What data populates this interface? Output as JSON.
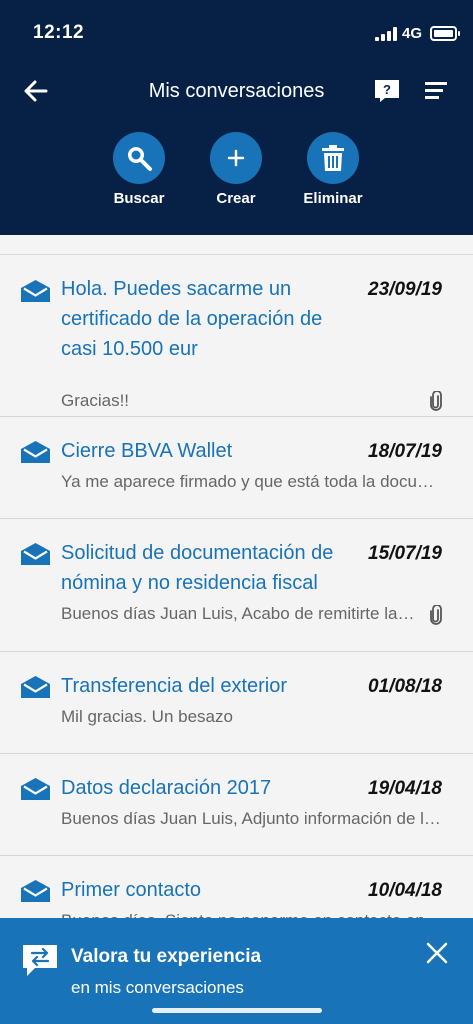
{
  "status_bar": {
    "time": "12:12",
    "network": "4G"
  },
  "header": {
    "title": "Mis conversaciones",
    "actions": [
      {
        "label": "Buscar",
        "icon": "search-icon"
      },
      {
        "label": "Crear",
        "icon": "plus-icon"
      },
      {
        "label": "Eliminar",
        "icon": "trash-icon"
      }
    ]
  },
  "conversations": [
    {
      "subject": "Hola. Puedes sacarme un certificado de la operación de casi 10.500 eur",
      "date": "23/09/19",
      "preview": "Gracias!!",
      "has_attachment": true
    },
    {
      "subject": "Cierre BBVA Wallet",
      "date": "18/07/19",
      "preview": "Ya me aparece firmado y que está toda la documentación",
      "has_attachment": false
    },
    {
      "subject": "Solicitud de documentación de nómina y no residencia fiscal",
      "date": "15/07/19",
      "preview": "Buenos días Juan Luis,  Acabo de remitirte la documentación",
      "has_attachment": true
    },
    {
      "subject": "Transferencia del exterior",
      "date": "01/08/18",
      "preview": "Mil gracias. Un besazo",
      "has_attachment": false
    },
    {
      "subject": "Datos declaración 2017",
      "date": "19/04/18",
      "preview": "Buenos días Juan Luis,  Adjunto información de la declaración",
      "has_attachment": false
    },
    {
      "subject": "Primer contacto",
      "date": "10/04/18",
      "preview": "Buenos días. Siento no ponerme en contacto antes",
      "has_attachment": false
    }
  ],
  "banner": {
    "title": "Valora tu experiencia",
    "subtitle": "en mis conversaciones"
  },
  "colors": {
    "header_bg": "#072146",
    "accent": "#1973b8",
    "list_bg": "#f4f4f4"
  }
}
